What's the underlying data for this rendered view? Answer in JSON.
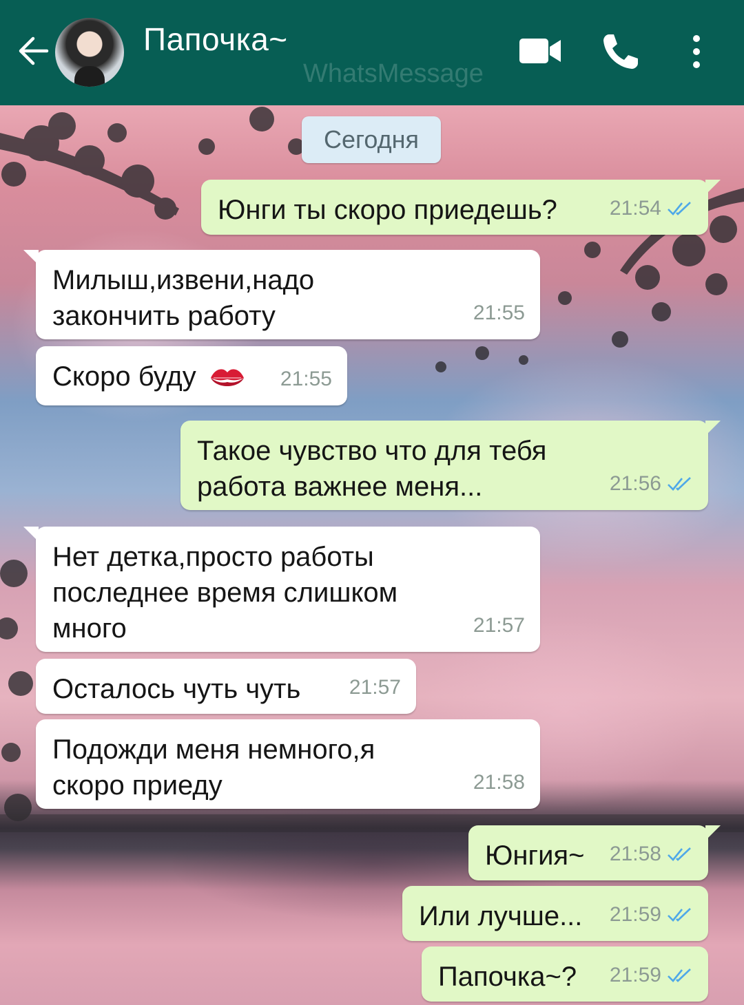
{
  "header": {
    "contact_name": "Папочка~",
    "watermark": "WhatsMessage",
    "icons": [
      "back-arrow-icon",
      "avatar",
      "video-call-icon",
      "phone-icon",
      "more-vert-icon"
    ],
    "bar_color": "#075e54"
  },
  "chat": {
    "date_chip": "Сегодня",
    "colors": {
      "incoming": "#ffffff",
      "outgoing": "#e1f8c6"
    },
    "messages": [
      {
        "dir": "out",
        "text": "Юнги ты скоро приедешь?",
        "time": "21:54",
        "status": "read"
      },
      {
        "dir": "in",
        "text": "Милыш,извени,надо\nзакончить работу",
        "time": "21:55"
      },
      {
        "dir": "in",
        "text": "Скоро буду",
        "emoji": "kiss-mark",
        "time": "21:55"
      },
      {
        "dir": "out",
        "text": "Такое чувство что для тебя\nработа важнее меня...",
        "time": "21:56",
        "status": "read"
      },
      {
        "dir": "in",
        "text": "Нет детка,просто работы\nпоследнее время слишком\nмного",
        "time": "21:57"
      },
      {
        "dir": "in",
        "text": "Осталось чуть чуть",
        "time": "21:57"
      },
      {
        "dir": "in",
        "text": "Подожди меня немного,я\nскоро приеду",
        "time": "21:58"
      },
      {
        "dir": "out",
        "text": "Юнгия~",
        "time": "21:58",
        "status": "read"
      },
      {
        "dir": "out",
        "text": "Или лучше...",
        "time": "21:59",
        "status": "read"
      },
      {
        "dir": "out",
        "text": "Папочка~?",
        "time": "21:59",
        "status": "read"
      }
    ]
  }
}
